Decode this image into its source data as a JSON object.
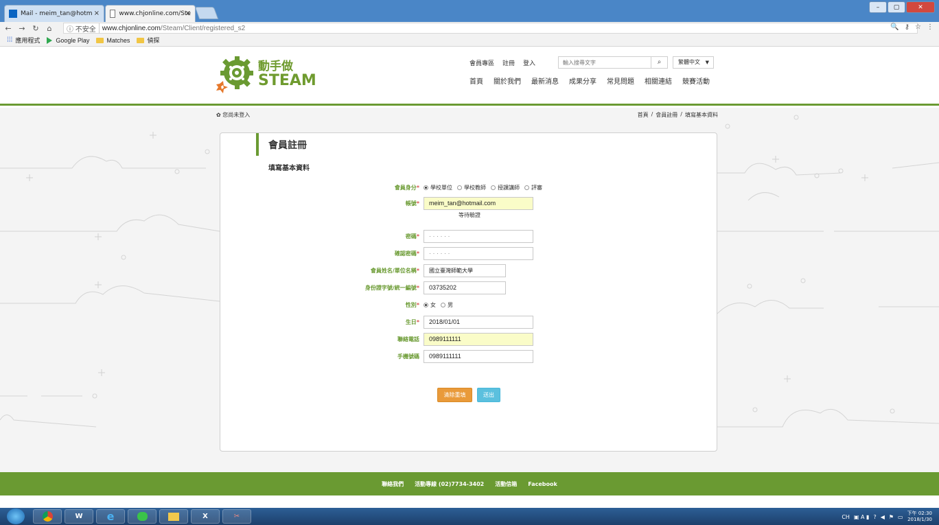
{
  "browser": {
    "tabs": [
      {
        "label": "Mail - meim_tan@hotm",
        "active": false
      },
      {
        "label": "www.chjonline.com/Ste",
        "active": true
      }
    ],
    "security_label": "ⓘ 不安全",
    "url_domain": "www.chjonline.com",
    "url_path": "/Steam/Client/registered_s2",
    "bookmarks": [
      "應用程式",
      "Google Play",
      "Matches",
      "偵探"
    ]
  },
  "header": {
    "logo_line1": "動手做",
    "logo_line2": "STEAM",
    "top_links": [
      "會員專區",
      "註冊",
      "登入"
    ],
    "search_placeholder": "輸入搜尋文字",
    "language": "繁體中文",
    "nav": [
      "首頁",
      "關於我們",
      "最新消息",
      "成果分享",
      "常見問題",
      "相關連結",
      "競賽活動"
    ]
  },
  "status": {
    "login_status": "您尚未登入",
    "breadcrumb": [
      "首頁",
      "/",
      "會員註冊",
      "/",
      "填寫基本資料"
    ]
  },
  "form": {
    "title": "會員註冊",
    "subtitle": "填寫基本資料",
    "identity_label": "會員身分",
    "identity_options": [
      "學校單位",
      "學校教師",
      "授課講師",
      "評審"
    ],
    "identity_selected": 0,
    "account_label": "帳號",
    "account_value": "meim_tan@hotmail.com",
    "account_hint": "等待驗證",
    "password_label": "密碼",
    "password_value": "· · · · · ·",
    "confirm_label": "確認密碼",
    "confirm_value": "· · · · · ·",
    "name_label": "會員姓名/單位名稱",
    "name_value": "國立臺灣師範大學",
    "id_label": "身份證字號/統一編號",
    "id_value": "03735202",
    "gender_label": "性別",
    "gender_options": [
      "女",
      "男"
    ],
    "gender_selected": 0,
    "birthday_label": "生日",
    "birthday_value": "2018/01/01",
    "phone_label": "聯絡電話",
    "phone_value": "0989111111",
    "mobile_label": "手機號碼",
    "mobile_value": "0989111111",
    "required_mark": "*",
    "reset_label": "清除重填",
    "submit_label": "送出"
  },
  "footer": {
    "items": [
      "聯絡我們",
      "活動專線 (02)7734-3402",
      "活動信箱",
      "Facebook"
    ]
  },
  "taskbar": {
    "clock_time": "下午 02:30",
    "clock_date": "2018/1/30",
    "ime": "CH"
  },
  "colors": {
    "brand_green": "#6a9a32",
    "reset_orange": "#e99a3a",
    "submit_blue": "#5bc0de"
  }
}
